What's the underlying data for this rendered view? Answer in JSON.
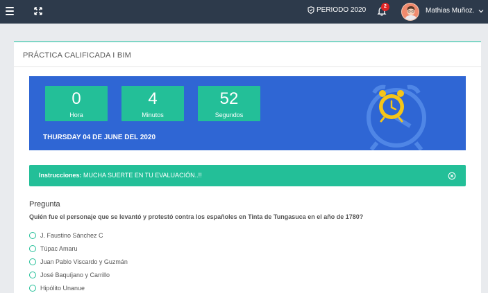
{
  "header": {
    "periodo_label": "PERIODO 2020",
    "notification_count": "2",
    "user_name": "Mathias Muñoz."
  },
  "card": {
    "title": "PRÁCTICA CALIFICADA I BIM"
  },
  "timer": {
    "hours": {
      "value": "0",
      "label": "Hora"
    },
    "minutes": {
      "value": "4",
      "label": "Minutos"
    },
    "seconds": {
      "value": "52",
      "label": "Segundos"
    },
    "date": "THURSDAY 04 DE JUNE DEL 2020"
  },
  "alert": {
    "label": "Instrucciones:",
    "message": "MUCHA SUERTE EN TU EVALUACIÓN..!!"
  },
  "question": {
    "heading": "Pregunta",
    "text": "Quién fue el personaje que se levantó y protestó contra los españoles en Tinta de Tungasuca en el año de 1780?",
    "options": [
      "J. Faustino Sánchez C",
      "Túpac Amaru",
      "Juan Pablo Viscardo y Guzmán",
      "José Baquíjano y Carrillo",
      "Hipólito Unanue"
    ]
  },
  "colors": {
    "topbar": "#2d3a4b",
    "timer_bg": "#2f66d4",
    "accent_green": "#23bf98",
    "clock_yellow": "#f5c518"
  },
  "icons": [
    "menu-icon",
    "expand-icon",
    "shield-icon",
    "bell-icon",
    "chevron-down-icon",
    "alarm-clock-icon",
    "close-circle-icon",
    "radio-icon"
  ]
}
